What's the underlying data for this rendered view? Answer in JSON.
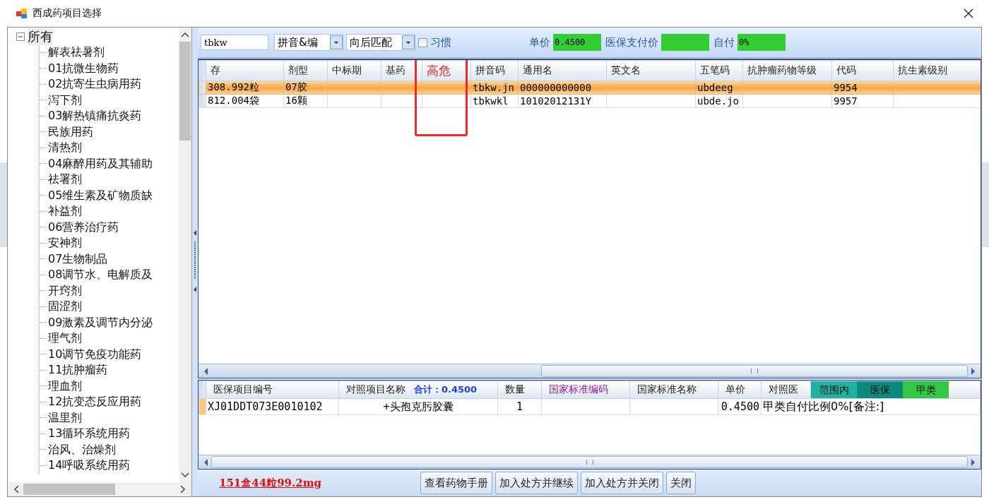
{
  "window": {
    "title": "西成药项目选择"
  },
  "tree": {
    "label": "所有",
    "expanded": true,
    "children": [
      {
        "label": "解表祛暑剂"
      },
      {
        "label": "01抗微生物药"
      },
      {
        "label": "02抗寄生虫病用药"
      },
      {
        "label": "泻下剂"
      },
      {
        "label": "03解热镇痛抗炎药"
      },
      {
        "label": "民族用药"
      },
      {
        "label": "清热剂"
      },
      {
        "label": "04麻醉用药及其辅助"
      },
      {
        "label": "祛署剂"
      },
      {
        "label": "05维生素及矿物质缺"
      },
      {
        "label": "补益剂"
      },
      {
        "label": "06营养治疗药"
      },
      {
        "label": "安神剂"
      },
      {
        "label": "07生物制品"
      },
      {
        "label": "08调节水、电解质及"
      },
      {
        "label": "开窍剂"
      },
      {
        "label": "固涩剂"
      },
      {
        "label": "09激素及调节内分泌"
      },
      {
        "label": "理气剂"
      },
      {
        "label": "10调节免疫功能药"
      },
      {
        "label": "11抗肿瘤药"
      },
      {
        "label": "理血剂"
      },
      {
        "label": "12抗变态反应用药"
      },
      {
        "label": "温里剂"
      },
      {
        "label": "13循环系统用药"
      },
      {
        "label": "治风、治燥剂"
      },
      {
        "label": "14呼吸系统用药"
      }
    ]
  },
  "toolbar": {
    "search": "tbkw",
    "code_type": "拼音&编",
    "match_mode": "向后匹配",
    "habit": {
      "label": "习惯",
      "checked": false
    },
    "price_label": "单价",
    "price": "0.4500",
    "insurance_price_label": "医保支付价",
    "self_pay_label": "自付",
    "self_pay": "0%"
  },
  "drug_table": {
    "columns": [
      {
        "label": "存",
        "highlighted": false
      },
      {
        "label": "剂型",
        "highlighted": false
      },
      {
        "label": "中标期",
        "highlighted": false
      },
      {
        "label": "基药",
        "highlighted": false
      },
      {
        "label": "高危",
        "highlighted": true
      },
      {
        "label": "拼音码",
        "highlighted": false
      },
      {
        "label": "通用名",
        "highlighted": false
      },
      {
        "label": "英文名",
        "highlighted": false
      },
      {
        "label": "五笔码",
        "highlighted": false
      },
      {
        "label": "抗肿瘤药物等级",
        "highlighted": false
      },
      {
        "label": "代码",
        "highlighted": false
      },
      {
        "label": "抗生素级别",
        "highlighted": false
      }
    ],
    "rows": [
      {
        "selected": true,
        "cells": [
          "308.992粒",
          "07胶",
          "",
          "",
          "",
          "tbkw.jn",
          "000000000000",
          "",
          "ubdeeg",
          "",
          "9954",
          ""
        ]
      },
      {
        "selected": false,
        "cells": [
          "812.004袋",
          "16颗",
          "",
          "",
          "",
          "tbkwkl",
          "10102012131Y",
          "",
          "ubde.jo",
          "",
          "9957",
          ""
        ]
      }
    ]
  },
  "prescription_table": {
    "columns": [
      "医保项目编号",
      "对照项目名称",
      "数量",
      "国家标准编码",
      "国家标准名称",
      "单价",
      "对照医"
    ],
    "total": "合计：0.4500",
    "tags": [
      {
        "label": "范围内",
        "color": "#22b0a0"
      },
      {
        "label": "医保",
        "color": "#0e8a7c"
      },
      {
        "label": "甲类",
        "color": "#33c843"
      }
    ],
    "rows": [
      {
        "cells": [
          "XJ01DDT073E0010102",
          "+头孢克肟胶囊",
          "1",
          "",
          "",
          "0.4500",
          "甲类自付比例0%[备注:]"
        ]
      }
    ]
  },
  "footer": {
    "stock": "151盒44粒99.2mg",
    "buttons": [
      "查看药物手册",
      "加入处方并继续",
      "加入处方并关闭",
      "关闭"
    ]
  }
}
